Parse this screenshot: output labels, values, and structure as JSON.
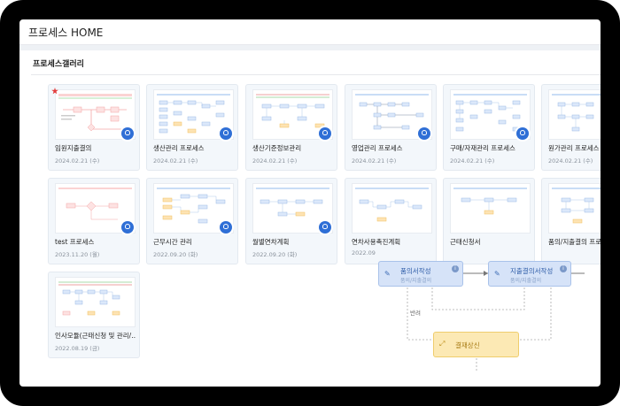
{
  "header": {
    "title": "프로세스 HOME"
  },
  "gallery": {
    "title": "프로세스갤러리",
    "cards": [
      {
        "title": "임원지출결의",
        "date": "2024.02.21 (수)",
        "starred": true
      },
      {
        "title": "생산관리 프로세스",
        "date": "2024.02.21 (수)"
      },
      {
        "title": "생산기준정보관리",
        "date": "2024.02.21 (수)"
      },
      {
        "title": "영업관리 프로세스",
        "date": "2024.02.21 (수)"
      },
      {
        "title": "구매/자재관리 프로세스",
        "date": "2024.02.21 (수)"
      },
      {
        "title": "원가관리 프로세스",
        "date": "2024.02.21 (수)"
      },
      {
        "title": "test 프로세스",
        "date": "2023.11.20 (월)"
      },
      {
        "title": "근무시간 관리",
        "date": "2022.09.20 (화)"
      },
      {
        "title": "월별연차계획",
        "date": "2022.09.20 (화)"
      },
      {
        "title": "연차사용촉진계획",
        "date": "2022.09"
      },
      {
        "title": "근태신청서",
        "date": ""
      },
      {
        "title": "품의/지출결의 프로세스",
        "date": ""
      },
      {
        "title": "인사모듈(근태신청 및 관리/…",
        "date": "2022.08.19 (금)"
      }
    ]
  },
  "flow": {
    "nodes": [
      {
        "id": "n1",
        "label": "품의서작성",
        "sub": "품의/지출결의",
        "color": "#d6e3f8"
      },
      {
        "id": "n2",
        "label": "지출결의서작성",
        "sub": "품의/지출결의",
        "color": "#d6e3f8"
      },
      {
        "id": "n3",
        "label": "결재상신",
        "sub": "",
        "color": "#fce9b4"
      }
    ],
    "edge_label": "반려"
  },
  "icons": {
    "profile_badge": "user-icon",
    "edit": "edit-icon",
    "merge": "merge-icon",
    "info": "info-icon"
  },
  "colors": {
    "badge": "#2f6fd6",
    "node_blue": "#d6e3f8",
    "node_yellow": "#fce9b4"
  }
}
